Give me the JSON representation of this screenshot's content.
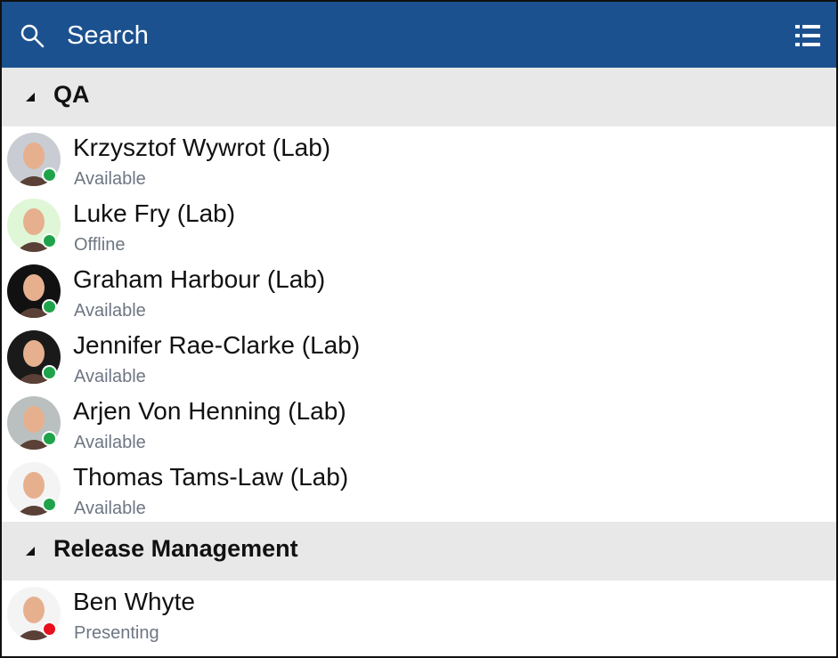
{
  "header": {
    "search_label": "Search",
    "search_icon": "search-icon",
    "menu_icon": "list-icon",
    "color": "#1c5190"
  },
  "groups": [
    {
      "name": "QA",
      "contacts": [
        {
          "name": "Krzysztof Wywrot (Lab)",
          "status": "Available",
          "presence_color": "#1fa34a",
          "avatar_bg": "#c9ccd3"
        },
        {
          "name": "Luke Fry (Lab)",
          "status": "Offline",
          "presence_color": "#1fa34a",
          "avatar_bg": "#dff7d6"
        },
        {
          "name": "Graham Harbour (Lab)",
          "status": "Available",
          "presence_color": "#1fa34a",
          "avatar_bg": "#111111"
        },
        {
          "name": "Jennifer Rae-Clarke (Lab)",
          "status": "Available",
          "presence_color": "#1fa34a",
          "avatar_bg": "#1a1a1a"
        },
        {
          "name": "Arjen Von Henning (Lab)",
          "status": "Available",
          "presence_color": "#1fa34a",
          "avatar_bg": "#b9c0bf"
        },
        {
          "name": "Thomas Tams-Law (Lab)",
          "status": "Available",
          "presence_color": "#1fa34a",
          "avatar_bg": "#f4f4f4"
        }
      ]
    },
    {
      "name": "Release Management",
      "contacts": [
        {
          "name": "Ben Whyte",
          "status": "Presenting",
          "presence_color": "#e8101c",
          "avatar_bg": "#f4f4f4"
        }
      ]
    }
  ]
}
